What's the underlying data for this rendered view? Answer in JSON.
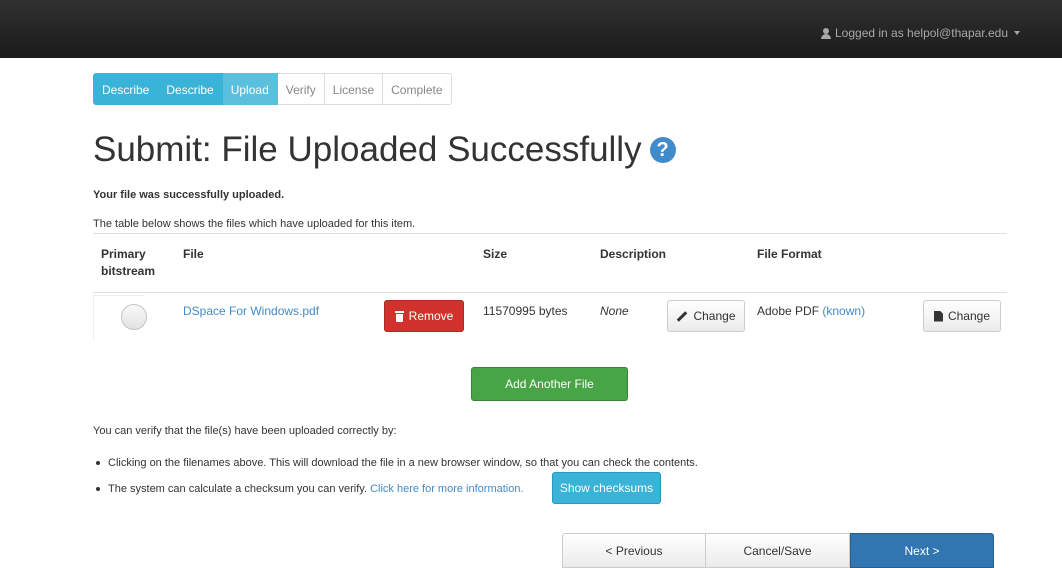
{
  "navbar": {
    "user_label": "Logged in as helpol@thapar.edu"
  },
  "steps": [
    {
      "label": "Describe",
      "state": "done"
    },
    {
      "label": "Describe",
      "state": "done"
    },
    {
      "label": "Upload",
      "state": "current"
    },
    {
      "label": "Verify",
      "state": "todo"
    },
    {
      "label": "License",
      "state": "todo"
    },
    {
      "label": "Complete",
      "state": "todo"
    }
  ],
  "page": {
    "title": "Submit: File Uploaded Successfully",
    "help_glyph": "?",
    "success_message": "Your file was successfully uploaded.",
    "table_intro": "The table below shows the files which have uploaded for this item."
  },
  "table": {
    "headers": {
      "primary": "Primary bitstream",
      "file": "File",
      "size": "Size",
      "description": "Description",
      "format": "File Format"
    },
    "row": {
      "file_name": "DSpace For Windows.pdf",
      "remove_label": "Remove",
      "size": "11570995 bytes",
      "description": "None",
      "change_description_label": "Change",
      "format_name": "Adobe PDF",
      "format_support": "(known)",
      "change_format_label": "Change"
    }
  },
  "add_file_label": "Add Another File",
  "verify": {
    "intro": "You can verify that the file(s) have been uploaded correctly by:",
    "bullet1": "Clicking on the filenames above. This will download the file in a new browser window, so that you can check the contents.",
    "bullet2_text": "The system can calculate a checksum you can verify.",
    "bullet2_link": "Click here for more information.",
    "show_checksums_label": "Show checksums"
  },
  "footer": {
    "previous_label": "< Previous",
    "cancel_label": "Cancel/Save",
    "next_label": "Next >"
  },
  "colors": {
    "step_done": "#39b3d7",
    "step_current": "#5bc0de",
    "danger": "#d2322d",
    "success": "#47a447",
    "info": "#39b3d7",
    "primary": "#3276b1",
    "link": "#428bca"
  },
  "icons": {
    "user": "user-icon",
    "help": "question-circle-icon",
    "remove": "trash-icon",
    "change_description": "pencil-icon",
    "change_format": "file-icon"
  }
}
